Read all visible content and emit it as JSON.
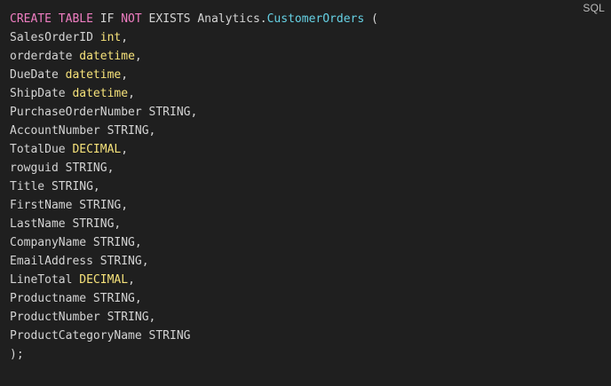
{
  "code_block": {
    "language_label": "SQL",
    "colors": {
      "background": "#1f1f1f",
      "text": "#d4d4d4",
      "keyword": "#f07ec2",
      "type": "#f6e27a",
      "identifier": "#66d1e4"
    },
    "lines": [
      [
        {
          "t": "kw",
          "v": "CREATE TABLE"
        },
        {
          "t": "txt",
          "v": " IF "
        },
        {
          "t": "kw",
          "v": "NOT"
        },
        {
          "t": "txt",
          "v": " EXISTS Analytics."
        },
        {
          "t": "id",
          "v": "CustomerOrders"
        },
        {
          "t": "txt",
          "v": " ("
        }
      ],
      [
        {
          "t": "txt",
          "v": "SalesOrderID "
        },
        {
          "t": "ty",
          "v": "int"
        },
        {
          "t": "txt",
          "v": ","
        }
      ],
      [
        {
          "t": "txt",
          "v": "orderdate "
        },
        {
          "t": "ty",
          "v": "datetime"
        },
        {
          "t": "txt",
          "v": ","
        }
      ],
      [
        {
          "t": "txt",
          "v": "DueDate "
        },
        {
          "t": "ty",
          "v": "datetime"
        },
        {
          "t": "txt",
          "v": ","
        }
      ],
      [
        {
          "t": "txt",
          "v": "ShipDate "
        },
        {
          "t": "ty",
          "v": "datetime"
        },
        {
          "t": "txt",
          "v": ","
        }
      ],
      [
        {
          "t": "txt",
          "v": "PurchaseOrderNumber STRING,"
        }
      ],
      [
        {
          "t": "txt",
          "v": "AccountNumber STRING,"
        }
      ],
      [
        {
          "t": "txt",
          "v": "TotalDue "
        },
        {
          "t": "ty",
          "v": "DECIMAL"
        },
        {
          "t": "txt",
          "v": ","
        }
      ],
      [
        {
          "t": "txt",
          "v": "rowguid STRING,"
        }
      ],
      [
        {
          "t": "txt",
          "v": "Title STRING,"
        }
      ],
      [
        {
          "t": "txt",
          "v": "FirstName STRING,"
        }
      ],
      [
        {
          "t": "txt",
          "v": "LastName STRING,"
        }
      ],
      [
        {
          "t": "txt",
          "v": "CompanyName STRING,"
        }
      ],
      [
        {
          "t": "txt",
          "v": "EmailAddress STRING,"
        }
      ],
      [
        {
          "t": "txt",
          "v": "LineTotal "
        },
        {
          "t": "ty",
          "v": "DECIMAL"
        },
        {
          "t": "txt",
          "v": ","
        }
      ],
      [
        {
          "t": "txt",
          "v": "Productname STRING,"
        }
      ],
      [
        {
          "t": "txt",
          "v": "ProductNumber STRING,"
        }
      ],
      [
        {
          "t": "txt",
          "v": "ProductCategoryName STRING"
        }
      ],
      [
        {
          "t": "txt",
          "v": ");"
        }
      ]
    ]
  }
}
